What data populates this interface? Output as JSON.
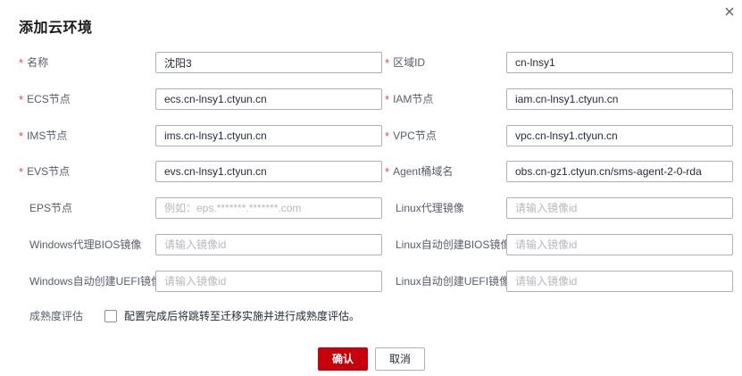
{
  "dialog": {
    "title": "添加云环境",
    "close_icon": "close-icon"
  },
  "form": {
    "required_mark": "*",
    "name": {
      "label": "名称",
      "value": "沈阳3"
    },
    "region_id": {
      "label": "区域ID",
      "value": "cn-lnsy1"
    },
    "ecs_endpoint": {
      "label": "ECS节点",
      "value": "ecs.cn-lnsy1.ctyun.cn"
    },
    "iam_endpoint": {
      "label": "IAM节点",
      "value": "iam.cn-lnsy1.ctyun.cn"
    },
    "ims_endpoint": {
      "label": "IMS节点",
      "value": "ims.cn-lnsy1.ctyun.cn"
    },
    "vpc_endpoint": {
      "label": "VPC节点",
      "value": "vpc.cn-lnsy1.ctyun.cn"
    },
    "evs_endpoint": {
      "label": "EVS节点",
      "value": "evs.cn-lnsy1.ctyun.cn"
    },
    "agent_bucket": {
      "label": "Agent桶域名",
      "value": "obs.cn-gz1.ctyun.cn/sms-agent-2-0-rda"
    },
    "eps_endpoint": {
      "label": "EPS节点",
      "value": "",
      "placeholder": "例如：eps.*******.*******.com"
    },
    "linux_proxy_image": {
      "label": "Linux代理镜像",
      "value": "",
      "placeholder": "请输入镜像id"
    },
    "windows_proxy_bios_image": {
      "label": "Windows代理BIOS镜像",
      "value": "",
      "placeholder": "请输入镜像id"
    },
    "linux_auto_bios_image": {
      "label": "Linux自动创建BIOS镜像",
      "value": "",
      "placeholder": "请输入镜像id"
    },
    "windows_auto_uefi_image": {
      "label": "Windows自动创建UEFI镜像",
      "value": "",
      "placeholder": "请输入镜像id"
    },
    "linux_auto_uefi_image": {
      "label": "Linux自动创建UEFI镜像",
      "value": "",
      "placeholder": "请输入镜像id"
    },
    "maturity": {
      "label": "成熟度评估",
      "checkbox_text": "配置完成后将跳转至迁移实施并进行成熟度评估。",
      "checked": false
    }
  },
  "footer": {
    "ok_label": "确认",
    "cancel_label": "取消"
  },
  "colors": {
    "primary": "#c7000b",
    "required": "#e5464c",
    "border": "#adb0b8",
    "placeholder": "#b6b8bf"
  }
}
